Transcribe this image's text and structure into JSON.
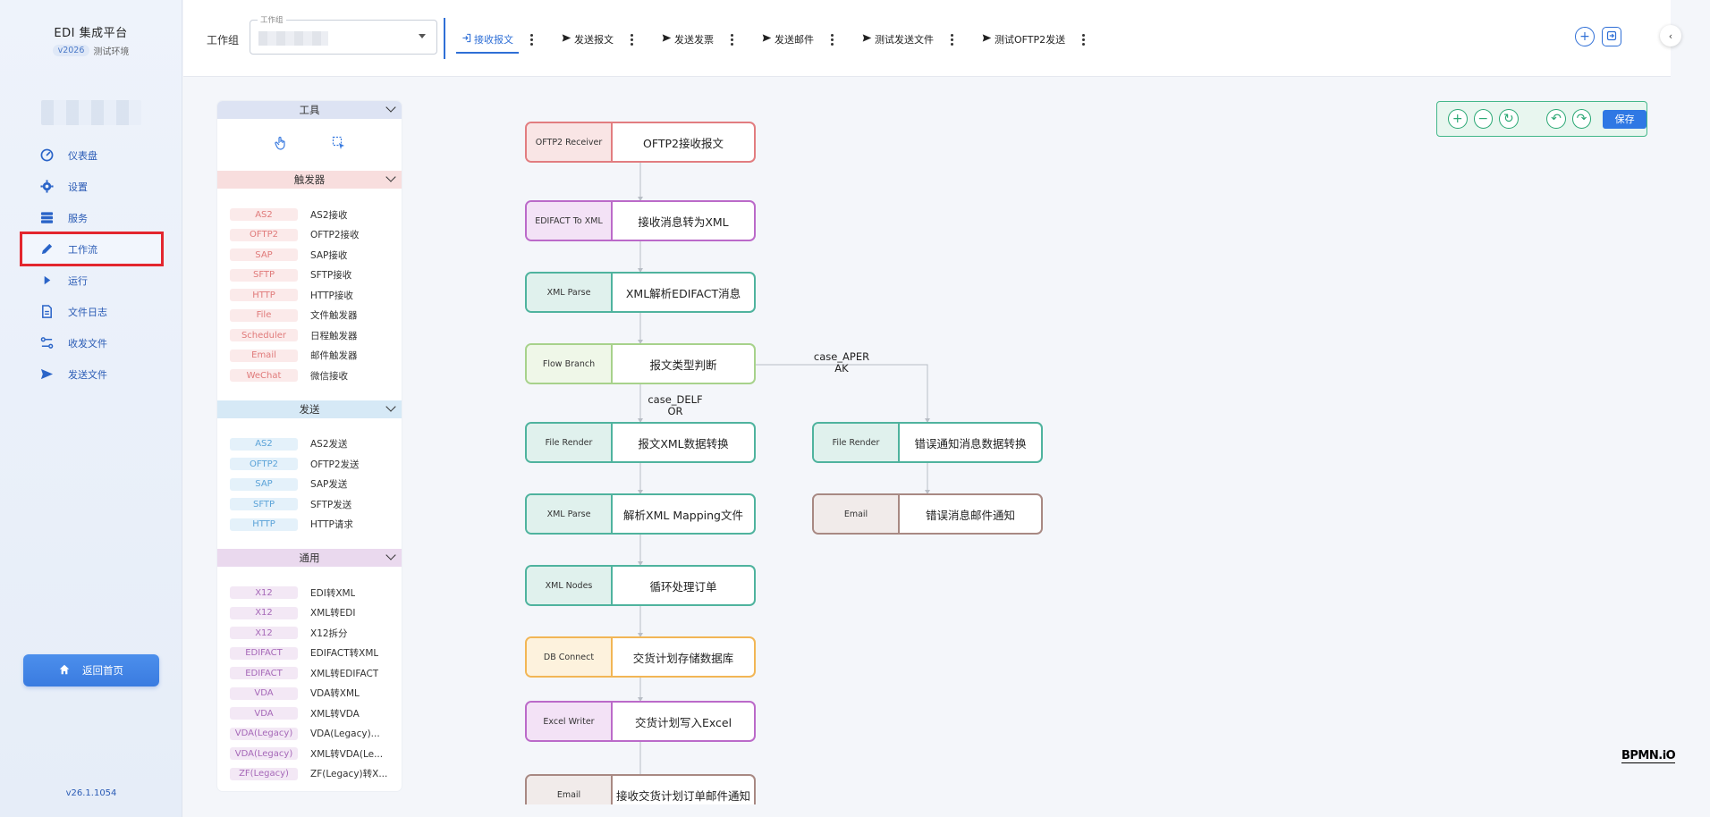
{
  "brand": {
    "title": "EDI 集成平台",
    "version_pill": "v2026",
    "env": "测试环境"
  },
  "sidebar": {
    "items": [
      {
        "label": "仪表盘",
        "icon": "dashboard-gauge-icon"
      },
      {
        "label": "设置",
        "icon": "gear-icon"
      },
      {
        "label": "服务",
        "icon": "server-icon"
      },
      {
        "label": "工作流",
        "icon": "pencil-icon",
        "active": true
      },
      {
        "label": "运行",
        "icon": "play-icon"
      },
      {
        "label": "文件日志",
        "icon": "document-icon"
      },
      {
        "label": "收发文件",
        "icon": "transfer-icon"
      },
      {
        "label": "发送文件",
        "icon": "send-icon"
      }
    ],
    "back_button": "返回首页",
    "app_version": "v26.1.1054"
  },
  "topbar": {
    "workgroup_label": "工作组",
    "workgroup_legend": "工作组",
    "tabs": [
      {
        "label": "接收报文",
        "icon": "login-icon",
        "active": true
      },
      {
        "label": "发送报文",
        "icon": "send-icon"
      },
      {
        "label": "发送发票",
        "icon": "send-icon"
      },
      {
        "label": "发送邮件",
        "icon": "send-icon"
      },
      {
        "label": "测试发送文件",
        "icon": "send-icon"
      },
      {
        "label": "测试OFTP2发送",
        "icon": "send-icon"
      }
    ]
  },
  "palette": {
    "tools_header": "工具",
    "triggers_header": "触发器",
    "triggers": [
      {
        "tag": "AS2",
        "name": "AS2接收"
      },
      {
        "tag": "OFTP2",
        "name": "OFTP2接收"
      },
      {
        "tag": "SAP",
        "name": "SAP接收"
      },
      {
        "tag": "SFTP",
        "name": "SFTP接收"
      },
      {
        "tag": "HTTP",
        "name": "HTTP接收"
      },
      {
        "tag": "File",
        "name": "文件触发器"
      },
      {
        "tag": "Scheduler",
        "name": "日程触发器"
      },
      {
        "tag": "Email",
        "name": "邮件触发器"
      },
      {
        "tag": "WeChat",
        "name": "微信接收"
      }
    ],
    "send_header": "发送",
    "send": [
      {
        "tag": "AS2",
        "name": "AS2发送"
      },
      {
        "tag": "OFTP2",
        "name": "OFTP2发送"
      },
      {
        "tag": "SAP",
        "name": "SAP发送"
      },
      {
        "tag": "SFTP",
        "name": "SFTP发送"
      },
      {
        "tag": "HTTP",
        "name": "HTTP请求"
      }
    ],
    "common_header": "通用",
    "common": [
      {
        "tag": "X12",
        "name": "EDI转XML"
      },
      {
        "tag": "X12",
        "name": "XML转EDI"
      },
      {
        "tag": "X12",
        "name": "X12拆分"
      },
      {
        "tag": "EDIFACT",
        "name": "EDIFACT转XML"
      },
      {
        "tag": "EDIFACT",
        "name": "XML转EDIFACT"
      },
      {
        "tag": "VDA",
        "name": "VDA转XML"
      },
      {
        "tag": "VDA",
        "name": "XML转VDA"
      },
      {
        "tag": "VDA(Legacy)",
        "name": "VDA(Legacy)..."
      },
      {
        "tag": "VDA(Legacy)",
        "name": "XML转VDA(Le..."
      },
      {
        "tag": "ZF(Legacy)",
        "name": "ZF(Legacy)转X..."
      }
    ]
  },
  "workflow": {
    "nodes": [
      {
        "type": "OFTP2 Receiver",
        "label": "OFTP2接收报文",
        "color": "#e27d80"
      },
      {
        "type": "EDIFACT To XML",
        "label": "接收消息转为XML",
        "color": "#bb6ac9"
      },
      {
        "type": "XML Parse",
        "label": "XML解析EDIFACT消息",
        "color": "#4fb39e"
      },
      {
        "type": "Flow Branch",
        "label": "报文类型判断",
        "color": "#a7d28b"
      },
      {
        "type": "File Render",
        "label": "报文XML数据转换",
        "color": "#4fb39e"
      },
      {
        "type": "XML Parse",
        "label": "解析XML Mapping文件",
        "color": "#4fb39e"
      },
      {
        "type": "XML Nodes",
        "label": "循环处理订单",
        "color": "#4fb39e"
      },
      {
        "type": "DB Connect",
        "label": "交货计划存储数据库",
        "color": "#f2b655"
      },
      {
        "type": "Excel Writer",
        "label": "交货计划写入Excel",
        "color": "#bb6ac9"
      },
      {
        "type": "Email",
        "label": "接收交货计划订单邮件通知",
        "color": "#a88983"
      },
      {
        "type": "File Render",
        "label": "错误通知消息数据转换",
        "color": "#4fb39e"
      },
      {
        "type": "Email",
        "label": "错误消息邮件通知",
        "color": "#a88983"
      }
    ],
    "edge_labels": {
      "case_aperak": "case_APER\nAK",
      "case_delfor": "case_DELF\nOR"
    }
  },
  "canvas_toolbar": {
    "save": "保存"
  },
  "watermark": "BPMN.iO"
}
